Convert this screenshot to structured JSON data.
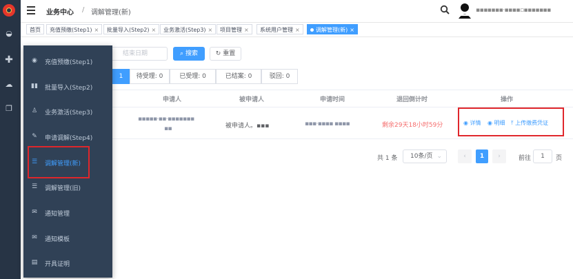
{
  "header": {
    "breadcrumb": [
      "业务中心",
      "/",
      "调解管理(新)"
    ],
    "user_name": "▪▪▪▪▪▪▪·▪▪▪▪▫▪▪▪▪▪▪▪"
  },
  "tags": [
    {
      "label": "首页",
      "closable": false
    },
    {
      "label": "充值预缴(Step1)",
      "closable": true
    },
    {
      "label": "批量导入(Step2)",
      "closable": true
    },
    {
      "label": "业务激活(Step3)",
      "closable": true
    },
    {
      "label": "项目管理",
      "closable": true
    },
    {
      "label": "系统用户管理",
      "closable": true
    },
    {
      "label": "调解管理(新)",
      "closable": true,
      "active": true
    }
  ],
  "filters": {
    "end_date_placeholder": "结束日期",
    "search_label": "搜索",
    "reset_label": "重置"
  },
  "status_tabs": [
    {
      "label": "1",
      "active": true
    },
    {
      "label": "待受理: 0"
    },
    {
      "label": "已受理: 0"
    },
    {
      "label": "已结案: 0"
    },
    {
      "label": "驳回: 0"
    }
  ],
  "table": {
    "headers": [
      "申请人",
      "被申请人",
      "申请时间",
      "退回倒计时",
      "操作"
    ],
    "row": {
      "applicant": "▪▪▪▪▪·▪▪·▪▪▪▪▪▪▪",
      "applicant2": "▪▪",
      "respondent": "被申请人。▪▪▪",
      "time": "▪▪▪·▪▪▪▪ ▪▪▪▪",
      "countdown": "剩余29天18小时59分",
      "actions": {
        "detail": "详情",
        "detail_list": "明细",
        "upload": "上传缴费凭证"
      }
    }
  },
  "pagination": {
    "total": "共 1 条",
    "page_size": "10条/页",
    "current": "1",
    "goto_label": "前往",
    "goto_value": "1",
    "page_suffix": "页"
  },
  "menu": [
    {
      "label": "充值预缴(Step1)",
      "icon": "circle-icon"
    },
    {
      "label": "批量导入(Step2)",
      "icon": "import-icon"
    },
    {
      "label": "业务激活(Step3)",
      "icon": "user-icon"
    },
    {
      "label": "申请调解(Step4)",
      "icon": "edit-icon"
    },
    {
      "label": "调解管理(新)",
      "icon": "list-icon",
      "active": true
    },
    {
      "label": "调解管理(旧)",
      "icon": "list-icon"
    },
    {
      "label": "通知管理",
      "icon": "mail-icon"
    },
    {
      "label": "通知模板",
      "icon": "mail-icon"
    },
    {
      "label": "开具证明",
      "icon": "document-icon"
    }
  ],
  "colors": {
    "primary": "#409eff",
    "highlight_box": "#e0262b",
    "countdown": "#f56c6c",
    "sidebar": "#304156"
  }
}
